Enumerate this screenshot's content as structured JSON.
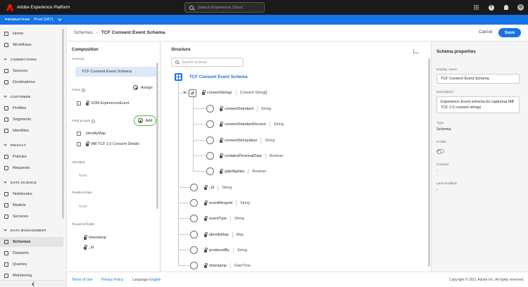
{
  "topbar": {
    "app_title": "Adobe Experience Platform",
    "search_placeholder": "Search Experience Cloud"
  },
  "envbar": {
    "label": "PRODUCTION",
    "sandbox": "Prod (VA7)"
  },
  "nav": {
    "home": "Home",
    "workflows": "Workflows",
    "s_connections": "CONNECTIONS",
    "sources": "Sources",
    "destinations": "Destinations",
    "s_customer": "CUSTOMER",
    "profiles": "Profiles",
    "segments": "Segments",
    "identities": "Identities",
    "s_privacy": "PRIVACY",
    "policies": "Policies",
    "requests": "Requests",
    "s_data_science": "DATA SCIENCE",
    "notebooks": "Notebooks",
    "models": "Models",
    "services": "Services",
    "s_data_management": "DATA MANAGEMENT",
    "schemas": "Schemas",
    "datasets": "Datasets",
    "queries": "Queries",
    "monitoring": "Monitoring"
  },
  "header": {
    "breadcrumb_parent": "Schemas",
    "breadcrumb_sep": "›",
    "breadcrumb_current": "TCF Consent Event Schema",
    "cancel": "Cancel",
    "save": "Save"
  },
  "composition": {
    "title": "Composition",
    "schema_label": "Schema",
    "schema_name": "TCF Consent Event Schema",
    "class_label": "Class",
    "assign": "Assign",
    "class_name": "XDM ExperienceEvent",
    "field_groups_label": "Field groups",
    "add": "Add",
    "field_groups": [
      "IdentityMap",
      "IAB TCF 2.0 Consent Details"
    ],
    "identities_label": "Identities",
    "identities_value": "None",
    "relationships_label": "Relationships",
    "relationships_value": "None",
    "required_label": "Required fields",
    "required_fields": [
      "timestamp",
      "_id"
    ]
  },
  "structure": {
    "title": "Structure",
    "search_placeholder": "Search schema",
    "root": "TCF Consent Event Schema",
    "consent": {
      "name": "consentStrings",
      "type": "Consent String[]"
    },
    "children": [
      {
        "name": "consentStandard",
        "type": "String"
      },
      {
        "name": "consentStandardVersion",
        "type": "String"
      },
      {
        "name": "consentStringValue",
        "type": "String"
      },
      {
        "name": "containsPersonalData",
        "type": "Boolean"
      },
      {
        "name": "gdprApplies",
        "type": "Boolean"
      }
    ],
    "fields": [
      {
        "name": "_id",
        "type": "String"
      },
      {
        "name": "eventMergeId",
        "type": "String"
      },
      {
        "name": "eventType",
        "type": "String"
      },
      {
        "name": "identityMap",
        "type": "Map"
      },
      {
        "name": "producedBy",
        "type": "String"
      },
      {
        "name": "timestamp",
        "type": "DateTime"
      }
    ]
  },
  "properties": {
    "title": "Schema properties",
    "display_name_label": "Display name",
    "display_name": "TCF Consent Event Schema",
    "description_label": "Description",
    "description": "Experience Event schema for capturing IAB TCF 2.0 consent strings",
    "type_label": "Type",
    "type": "Schema",
    "profile_label": "Profile",
    "created_label": "Created",
    "created": "-",
    "modified_label": "Last modified",
    "modified": "-"
  },
  "footer": {
    "terms": "Terms of Use",
    "privacy": "Privacy Policy",
    "language_label": "Language:",
    "language": "English",
    "copyright": "Copyright © 2021 Adobe Inc. All rights reserved."
  },
  "colors": {
    "accent": "#1473e6",
    "highlight": "#3ec53e",
    "brand": "#fa0f00"
  }
}
